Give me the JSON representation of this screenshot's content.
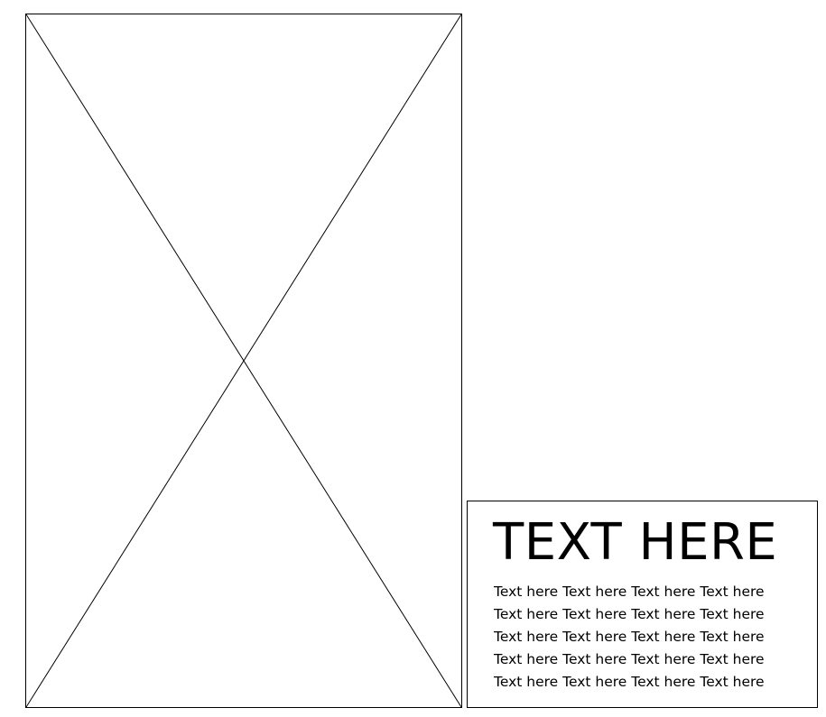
{
  "image_placeholder": {
    "icon": "image-placeholder-cross-icon"
  },
  "text_block": {
    "headline": "TEXT HERE",
    "lines": [
      "Text here Text here Text here Text here",
      "Text here Text here Text here Text here",
      "Text here Text here Text here Text here",
      "Text here Text here Text here Text here",
      "Text here Text here Text here Text here"
    ]
  },
  "colors": {
    "stroke": "#000000",
    "background": "#ffffff"
  }
}
